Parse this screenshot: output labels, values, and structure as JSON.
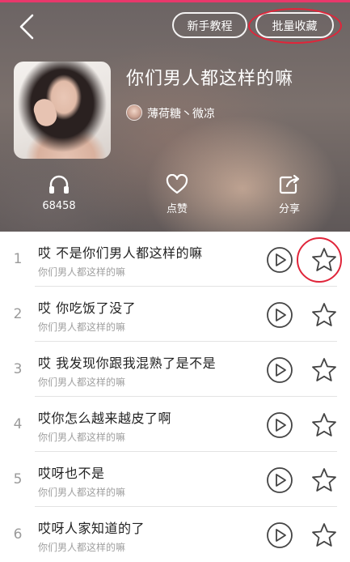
{
  "colors": {
    "accent": "#e8386b",
    "annotation": "#e0253a",
    "text_primary": "#222222",
    "text_secondary": "#a0a0a0"
  },
  "header": {
    "tutorial_label": "新手教程",
    "batch_collect_label": "批量收藏",
    "album_title": "你们男人都这样的嘛",
    "author_name": "薄荷糖丶微凉",
    "listen_count": "68458",
    "like_label": "点赞",
    "share_label": "分享"
  },
  "songs": [
    {
      "index": "1",
      "title": "哎 不是你们男人都这样的嘛",
      "album": "你们男人都这样的嘛"
    },
    {
      "index": "2",
      "title": "哎 你吃饭了没了",
      "album": "你们男人都这样的嘛"
    },
    {
      "index": "3",
      "title": "哎 我发现你跟我混熟了是不是",
      "album": "你们男人都这样的嘛"
    },
    {
      "index": "4",
      "title": "哎你怎么越来越皮了啊",
      "album": "你们男人都这样的嘛"
    },
    {
      "index": "5",
      "title": "哎呀也不是",
      "album": "你们男人都这样的嘛"
    },
    {
      "index": "6",
      "title": "哎呀人家知道的了",
      "album": "你们男人都这样的嘛"
    }
  ]
}
